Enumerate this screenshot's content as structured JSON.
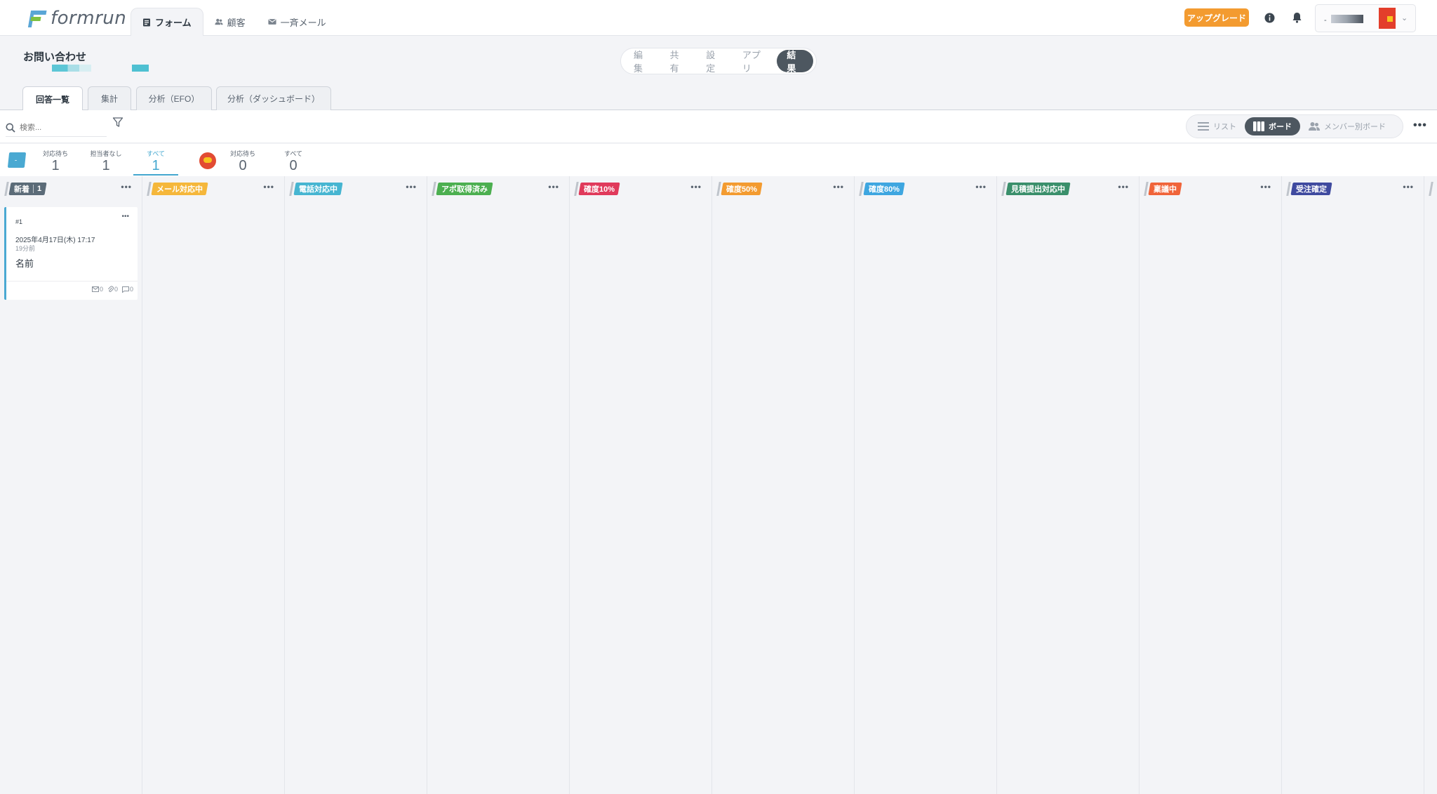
{
  "header": {
    "logo_text": "formrun",
    "nav": [
      {
        "label": "フォーム",
        "icon": "form-icon"
      },
      {
        "label": "顧客",
        "icon": "people-icon"
      },
      {
        "label": "一斉メール",
        "icon": "mail-icon"
      }
    ],
    "upgrade_label": "アップグレード",
    "account_prefix": "-"
  },
  "form": {
    "title": "お問い合わせ",
    "modes": [
      "編集",
      "共有",
      "設定",
      "アプリ",
      "結果"
    ],
    "active_mode": "結果"
  },
  "sub_tabs": [
    "回答一覧",
    "集計",
    "分析（EFO）",
    "分析（ダッシュボード）"
  ],
  "toolbar": {
    "search_placeholder": "検索...",
    "views": [
      "リスト",
      "ボード",
      "メンバー別ボード"
    ],
    "active_view": "ボード"
  },
  "counters": {
    "group_a_label": "-",
    "group_a": [
      {
        "label": "対応待ち",
        "value": "1"
      },
      {
        "label": "担当者なし",
        "value": "1"
      },
      {
        "label": "すべて",
        "value": "1"
      }
    ],
    "group_b": [
      {
        "label": "対応待ち",
        "value": "0"
      },
      {
        "label": "すべて",
        "value": "0"
      }
    ]
  },
  "columns": [
    {
      "label": "新着",
      "count": "1",
      "color": "#5b6b78"
    },
    {
      "label": "メール対応中",
      "color": "#f5b73b"
    },
    {
      "label": "電話対応中",
      "color": "#46b5d1"
    },
    {
      "label": "アポ取得済み",
      "color": "#4caf50"
    },
    {
      "label": "確度10%",
      "color": "#e03a5b"
    },
    {
      "label": "確度50%",
      "color": "#f39b30"
    },
    {
      "label": "確度80%",
      "color": "#3ea6e0"
    },
    {
      "label": "見積提出対応中",
      "color": "#3a8f6b"
    },
    {
      "label": "稟議中",
      "color": "#f0643a"
    },
    {
      "label": "受注確定",
      "color": "#3f4a9f"
    }
  ],
  "card": {
    "id": "#1",
    "date": "2025年4月17日(木) 17:17",
    "ago": "19分前",
    "name": "名前",
    "mail_count": "0",
    "attach_count": "0",
    "comment_count": "0"
  }
}
